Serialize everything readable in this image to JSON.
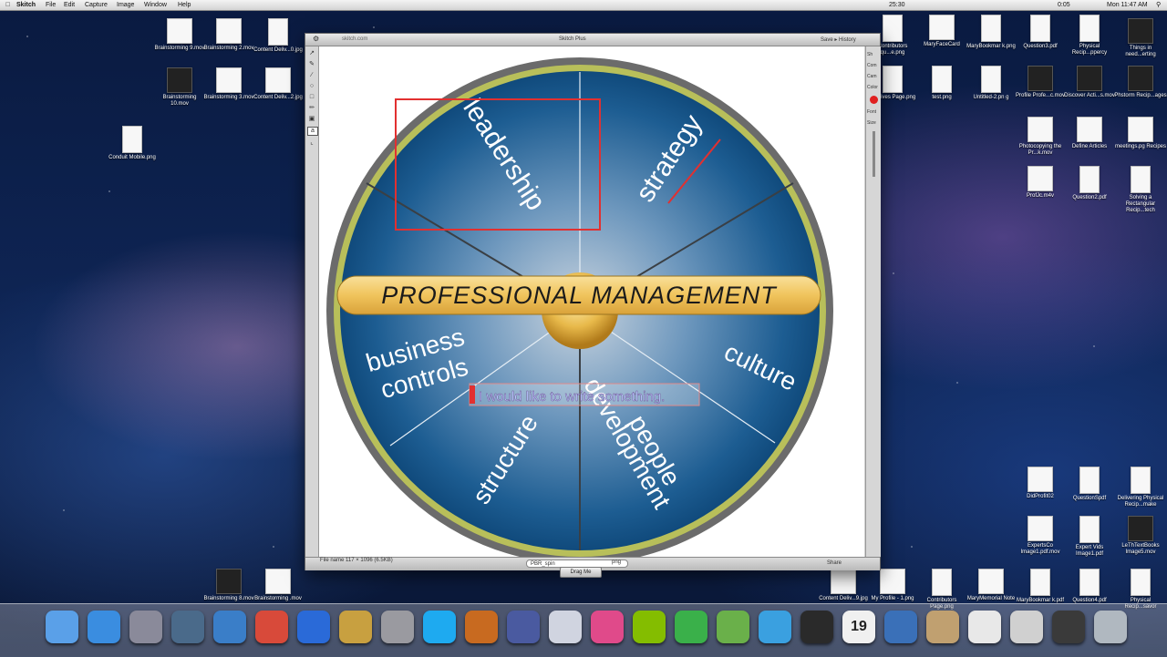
{
  "menubar": {
    "app_name": "Skitch",
    "menus": [
      "File",
      "Edit",
      "Capture",
      "Image",
      "Window",
      "Help"
    ],
    "status_clock": "Mon 11:47 AM",
    "battery": "0:05",
    "timer": "25:30"
  },
  "window": {
    "url": "skitch.com",
    "title": "Skitch Plus",
    "save_history": "Save ▸ History",
    "right_tools": [
      "Sh",
      "Com",
      "Cam",
      "Color",
      "Font",
      "Size"
    ],
    "file_name_value": "PBR_spin",
    "file_ext": "png",
    "share_label": "Share",
    "drag_me": "Drag Me",
    "status_info": "File name\n117 × 1096 (6.5KB)"
  },
  "diagram": {
    "center_banner": "PROFESSIONAL MANAGEMENT",
    "segments": {
      "leadership": "leadership",
      "strategy": "strategy",
      "business_line1": "business",
      "business_line2": "controls",
      "culture": "culture",
      "structure": "structure",
      "people_line1": "people",
      "people_line2": "development"
    },
    "annotation_text": "I would like to write something.",
    "colors": {
      "disk_blue": "#1a5a8e",
      "rim_olive": "#b8bf5a",
      "banner_gold": "#f1c45a",
      "annotation_red": "#e23030"
    }
  },
  "desktop_icons_left": [
    {
      "name": "Brainstorming 9.mov"
    },
    {
      "name": "Brainstorming 2.mov"
    },
    {
      "name": "Content Deliv...0.jpg"
    },
    {
      "name": "Brainstorming 10.mov"
    },
    {
      "name": "Brainstorming 3.mov"
    },
    {
      "name": "Content Deliv...2.jpg"
    },
    {
      "name": "Conduit Mobile.png"
    }
  ],
  "desktop_icons_right": [
    {
      "name": "Contributors qu...e.png"
    },
    {
      "name": "MaryFaceCard"
    },
    {
      "name": "MaryBookmar k.png"
    },
    {
      "name": "Question3.pdf"
    },
    {
      "name": "Physical Recip...ppercy"
    },
    {
      "name": "Things in need...erting"
    },
    {
      "name": "Archives Page.png"
    },
    {
      "name": "test.png"
    },
    {
      "name": "Untitled-2.pn g"
    },
    {
      "name": "Profile Profe...c.mov"
    },
    {
      "name": "Discover Acti...s.mov"
    },
    {
      "name": "Phstorm Recip...ages"
    },
    {
      "name": "Photocopying the Pr...k.mov"
    },
    {
      "name": "Define Articles"
    },
    {
      "name": "meetings.pg Recipes"
    },
    {
      "name": "ProfJc.m4v"
    },
    {
      "name": "Question2.pdf"
    },
    {
      "name": "Solving a Rectangular Recip...tech"
    },
    {
      "name": "DidProfit02"
    },
    {
      "name": "QuestionSpdf"
    },
    {
      "name": "Delivering Physical Recip...make"
    },
    {
      "name": "ExpertsCo Image1.pdf.mov"
    },
    {
      "name": "Expert Vids Image1.pdf"
    },
    {
      "name": "LeThTextBooks Image5.mov"
    },
    {
      "name": "Content Deliv...9.jpg"
    },
    {
      "name": "My Profile - 1.png"
    },
    {
      "name": "Contributors Page.png"
    },
    {
      "name": "MaryMemorial Note"
    },
    {
      "name": "MaryBookmar k.pdf"
    },
    {
      "name": "Question4.pdf"
    },
    {
      "name": "Physical Recip...savor"
    }
  ],
  "desktop_icons_bottom": [
    {
      "name": "Brainstorming 8.mov"
    },
    {
      "name": "Brainstorming .mov"
    }
  ],
  "dock_items": [
    {
      "icon": "finder-icon",
      "color": "#5aa0e8"
    },
    {
      "icon": "app-store-icon",
      "color": "#3a8de0"
    },
    {
      "icon": "launchpad-icon",
      "color": "#8a8a9a"
    },
    {
      "icon": "mission-control-icon",
      "color": "#4a6a8a"
    },
    {
      "icon": "safari-icon",
      "color": "#3a7ec8"
    },
    {
      "icon": "chrome-icon",
      "color": "#d84a3a"
    },
    {
      "icon": "itunes-icon",
      "color": "#2a6ad8"
    },
    {
      "icon": "iphoto-icon",
      "color": "#c8a040"
    },
    {
      "icon": "system-preferences-icon",
      "color": "#9a9aa0"
    },
    {
      "icon": "skype-icon",
      "color": "#1eaaf0"
    },
    {
      "icon": "keynote-icon",
      "color": "#c86a20"
    },
    {
      "icon": "quicktime-icon",
      "color": "#4a5aa0"
    },
    {
      "icon": "pages-icon",
      "color": "#d0d4e0"
    },
    {
      "icon": "heart-app-icon",
      "color": "#e04a8a"
    },
    {
      "icon": "spotify-icon",
      "color": "#84bd00"
    },
    {
      "icon": "adium-icon",
      "color": "#3ab04a"
    },
    {
      "icon": "evernote-icon",
      "color": "#6ab04a"
    },
    {
      "icon": "twitter-icon",
      "color": "#3aa0e0"
    },
    {
      "icon": "activity-monitor-icon",
      "color": "#2a2a2a"
    },
    {
      "icon": "calendar-icon",
      "color": "#f0f0f0",
      "label": "19"
    },
    {
      "icon": "quicktime-player-icon",
      "color": "#3a70b8"
    },
    {
      "icon": "home-folder-icon",
      "color": "#c0a070"
    },
    {
      "icon": "document-icon",
      "color": "#e8e8e8"
    },
    {
      "icon": "downloads-icon",
      "color": "#d0d0d0"
    },
    {
      "icon": "printer-icon",
      "color": "#3a3a3a"
    },
    {
      "icon": "trash-icon",
      "color": "#b0b8c0"
    }
  ]
}
